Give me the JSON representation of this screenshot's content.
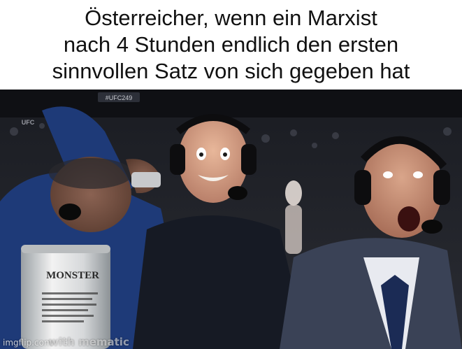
{
  "caption": {
    "lines": [
      "Österreicher, wenn ein Marxist",
      "nach 4 Stunden endlich den ersten",
      "sinnvollen Satz von sich gegeben hat"
    ]
  },
  "photo": {
    "can_brand": "MONSTER",
    "arena_sign": "UFC",
    "event_sign": "#UFC249"
  },
  "watermark": {
    "site": "imgflip.com",
    "made_with": "with mematic"
  }
}
